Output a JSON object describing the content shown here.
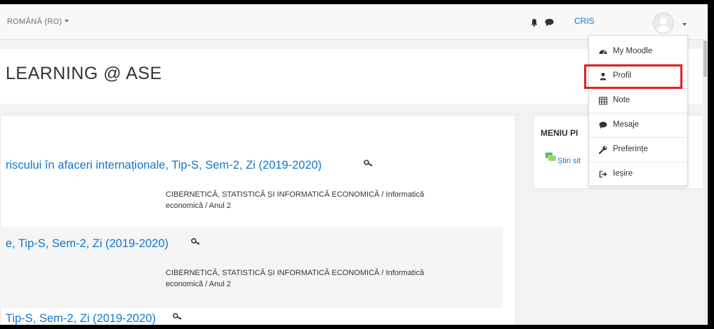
{
  "navbar": {
    "language": "ROMÂNĂ (RO)",
    "user_name": "CRIS",
    "icons": [
      "bell-icon",
      "chat-icon",
      "avatar-icon"
    ]
  },
  "header": {
    "site_title": "LEARNING @ ASE"
  },
  "courses": [
    {
      "title": "riscului în afaceri internaționale, Tip-S, Sem-2, Zi (2019-2020)",
      "category_line1": "CIBERNETICĂ, STATISTICĂ ȘI INFORMATICĂ ECONOMICĂ / Informatică",
      "category_line2": "economică / Anul 2"
    },
    {
      "title": "e, Tip-S, Sem-2, Zi (2019-2020)",
      "category_line1": "CIBERNETICĂ, STATISTICĂ ȘI INFORMATICĂ ECONOMICĂ / Informatică",
      "category_line2": "economică / Anul 2"
    },
    {
      "title": "Tip-S, Sem-2, Zi (2019-2020)"
    }
  ],
  "block": {
    "title": "MENIU PI",
    "link": "Știri sit"
  },
  "user_menu": {
    "items": [
      {
        "label": "My Moodle",
        "icon": "dashboard-icon"
      },
      {
        "label": "Profil",
        "icon": "user-icon"
      },
      {
        "label": "Note",
        "icon": "table-icon"
      },
      {
        "label": "Mesaje",
        "icon": "chat-icon"
      },
      {
        "label": "Preferințe",
        "icon": "wrench-icon"
      },
      {
        "label": "Ieșire",
        "icon": "logout-icon"
      }
    ]
  },
  "colors": {
    "link": "#1177d1",
    "highlight": "#e31e24"
  }
}
